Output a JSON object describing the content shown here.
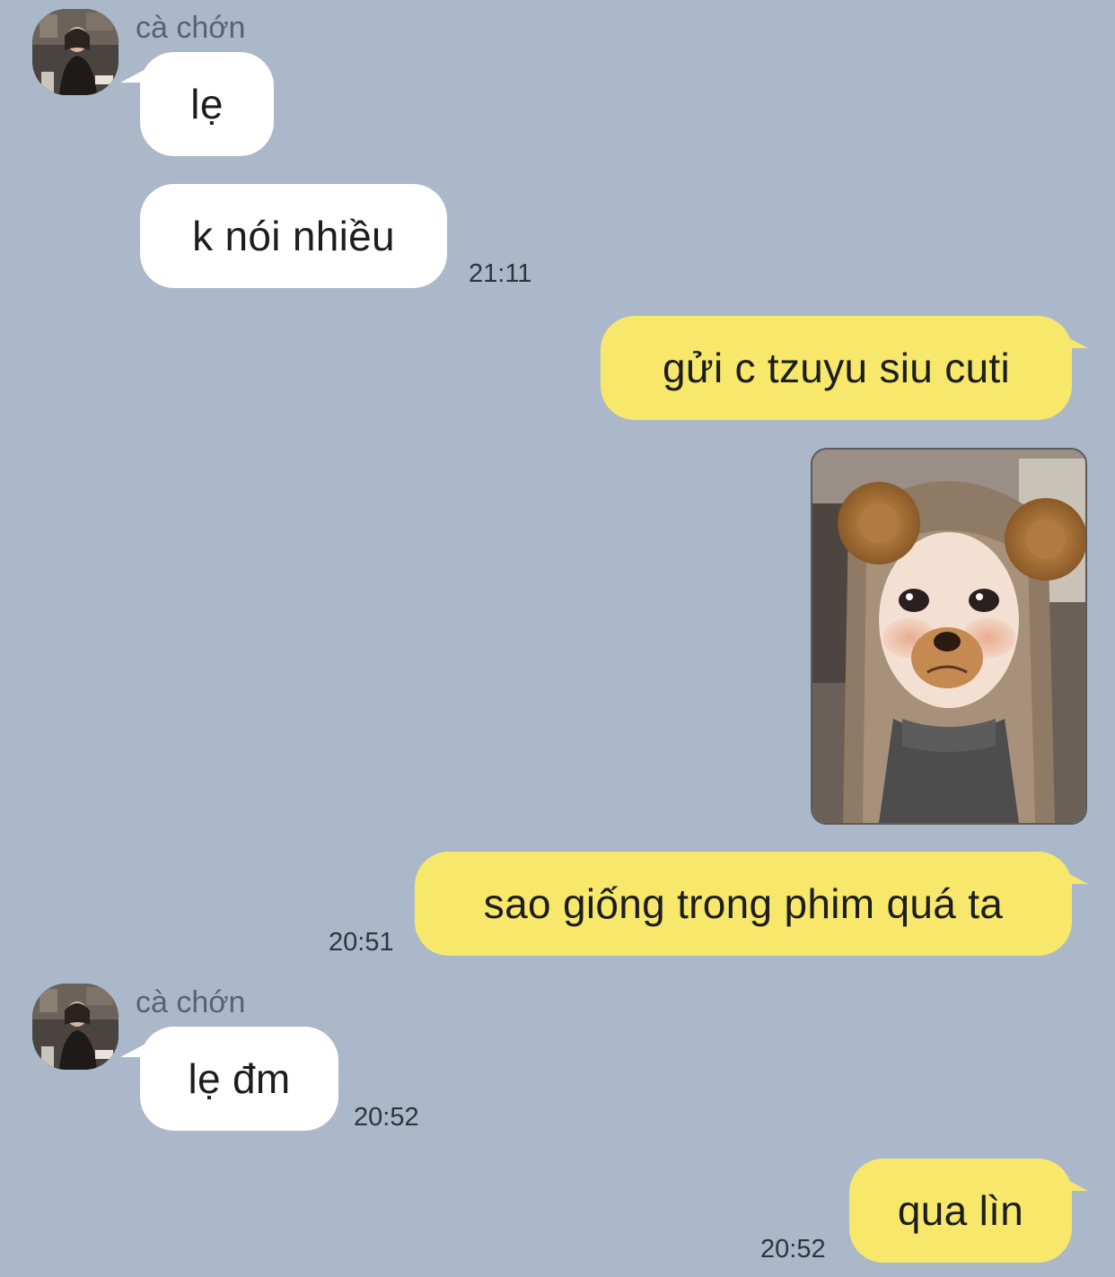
{
  "contact": {
    "name": "cà chớn"
  },
  "messages": [
    {
      "id": "m1",
      "side": "in",
      "text": "lẹ"
    },
    {
      "id": "m2",
      "side": "in",
      "text": "k nói nhiều",
      "time": "21:11"
    },
    {
      "id": "m3",
      "side": "out",
      "text": "gửi c tzuyu siu cuti"
    },
    {
      "id": "m4",
      "side": "out",
      "type": "image",
      "image": "photo-girl-with-bear-filter"
    },
    {
      "id": "m5",
      "side": "out",
      "text": "sao giống trong phim quá ta",
      "time": "20:51"
    },
    {
      "id": "m6",
      "side": "in",
      "text": "lẹ đm",
      "time": "20:52"
    },
    {
      "id": "m7",
      "side": "out",
      "text": "qua lìn",
      "time": "20:52"
    }
  ],
  "colors": {
    "background": "#abb8c9",
    "incoming_bubble": "#ffffff",
    "outgoing_bubble": "#f7e86b"
  }
}
